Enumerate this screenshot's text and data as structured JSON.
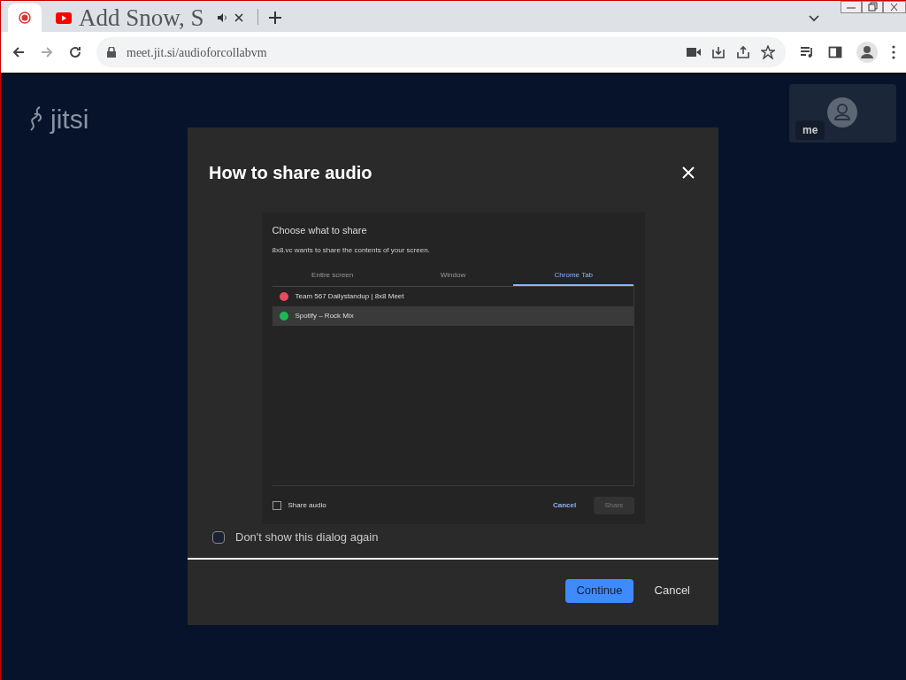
{
  "browser": {
    "tabs": [
      {
        "kind": "recording",
        "selected": true
      },
      {
        "kind": "video",
        "title": "Add Snow, S",
        "audio": true,
        "selected": false
      }
    ],
    "address": "meet.jit.si/audioforcollabvm"
  },
  "page": {
    "logo": "jitsi",
    "self_view": {
      "label": "me"
    }
  },
  "dialog": {
    "title": "How to share audio",
    "example": {
      "title": "Choose what to share",
      "subtitle": "8x8.vc wants to share the contents of your screen.",
      "tabs": [
        {
          "label": "Entire screen",
          "selected": false
        },
        {
          "label": "Window",
          "selected": false
        },
        {
          "label": "Chrome Tab",
          "selected": true
        }
      ],
      "items": [
        {
          "label": "Team 567 Dailystandup | 8x8 Meet",
          "color": "#e84a5f",
          "selected": false
        },
        {
          "label": "Spotify – Rock Mix",
          "color": "#1db954",
          "selected": true
        }
      ],
      "share_audio": {
        "label": "Share audio",
        "checked": false
      },
      "buttons": [
        {
          "label": "Cancel",
          "disabled": false
        },
        {
          "label": "Share",
          "disabled": true
        }
      ]
    },
    "dont_show": {
      "label": "Don't show this dialog again",
      "checked": false
    },
    "buttons": [
      {
        "label": "Continue",
        "primary": true
      },
      {
        "label": "Cancel",
        "primary": false
      }
    ]
  }
}
